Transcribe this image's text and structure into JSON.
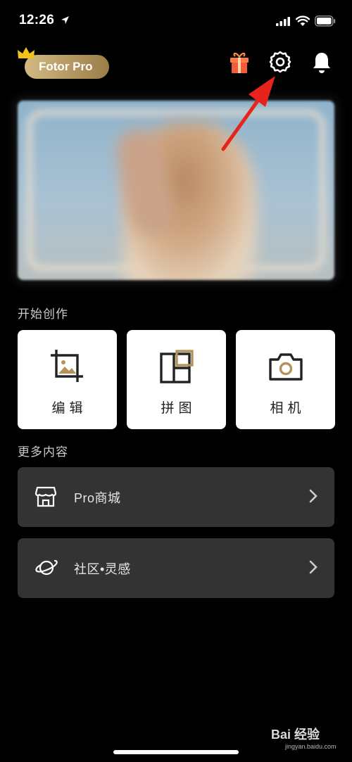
{
  "status_bar": {
    "time": "12:26"
  },
  "header": {
    "pro_badge": "Fotor Pro",
    "icons": [
      "crown-icon",
      "gift-icon",
      "gear-icon",
      "bell-icon"
    ]
  },
  "sections": {
    "start_title": "开始创作",
    "more_title": "更多内容"
  },
  "cards": [
    {
      "label": "编辑",
      "icon": "edit-crop-image-icon"
    },
    {
      "label": "拼图",
      "icon": "collage-icon"
    },
    {
      "label": "相机",
      "icon": "camera-icon"
    }
  ],
  "rows": [
    {
      "label": "Pro商城",
      "icon": "store-icon"
    },
    {
      "label": "社区•灵感",
      "icon": "planet-icon"
    }
  ],
  "watermark": {
    "text": "Bai 经验",
    "sub": "jingyan.baidu.com"
  },
  "colors": {
    "accent_gold": "#b39359",
    "annotation_red": "#e8231b",
    "row_bg": "#333333"
  }
}
